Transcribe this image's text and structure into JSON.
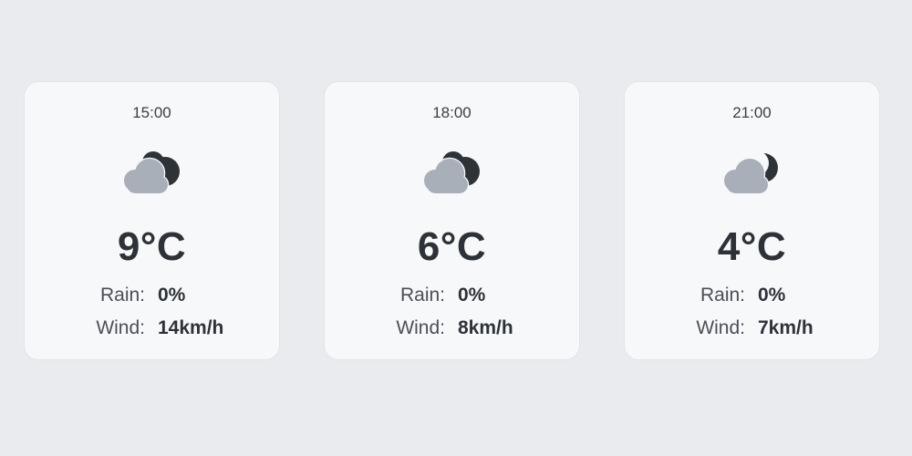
{
  "forecast": [
    {
      "time": "15:00",
      "icon": "cloudy-night-icon",
      "temperature": "9°C",
      "rain_label": "Rain:",
      "rain_value": "0%",
      "wind_label": "Wind:",
      "wind_value": "14km/h"
    },
    {
      "time": "18:00",
      "icon": "cloudy-night-icon",
      "temperature": "6°C",
      "rain_label": "Rain:",
      "rain_value": "0%",
      "wind_label": "Wind:",
      "wind_value": "8km/h"
    },
    {
      "time": "21:00",
      "icon": "cloudy-night-icon",
      "temperature": "4°C",
      "rain_label": "Rain:",
      "rain_value": "0%",
      "wind_label": "Wind:",
      "wind_value": "7km/h"
    }
  ],
  "colors": {
    "background": "#e9ebef",
    "card": "#f7f8fa",
    "cloud": "#a8afb8",
    "moon": "#2e3338",
    "text": "#2d3238"
  }
}
